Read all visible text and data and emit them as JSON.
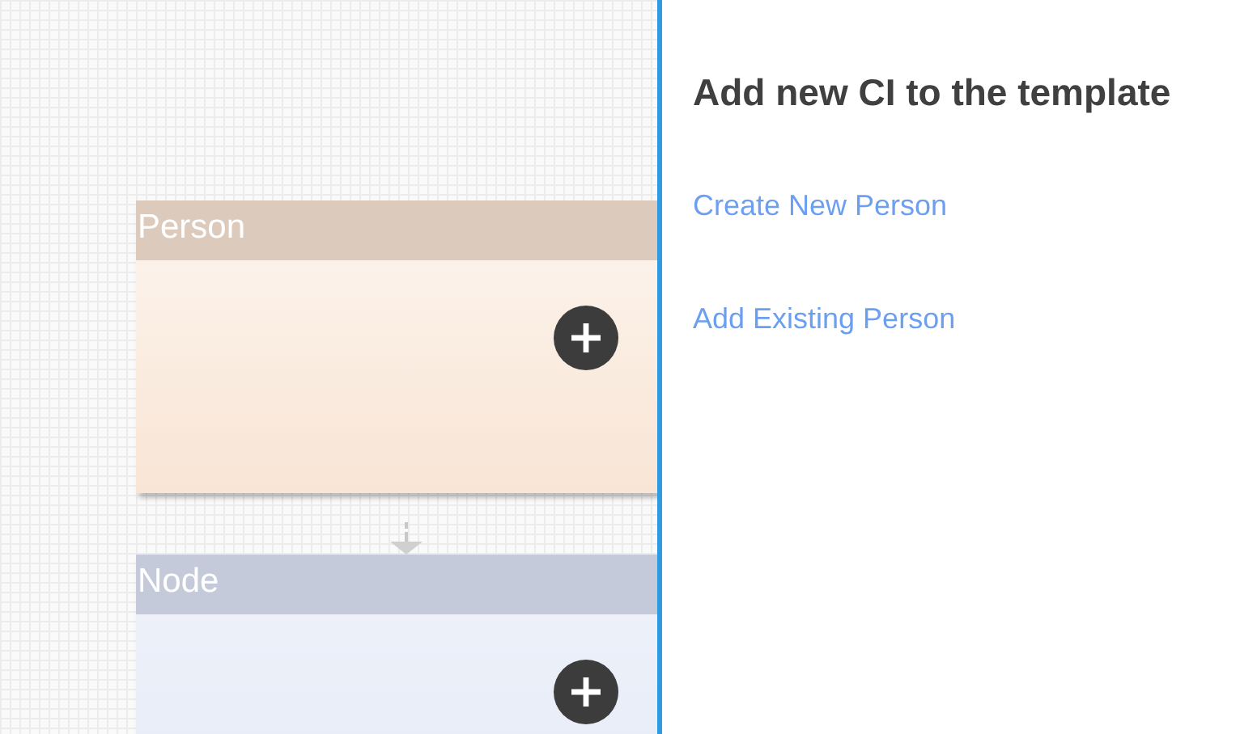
{
  "canvas": {
    "nodes": [
      {
        "title": "Person",
        "kind": "person"
      },
      {
        "title": "Node",
        "kind": "node"
      }
    ]
  },
  "panel": {
    "title": "Add new CI to the template",
    "links": [
      "Create New Person",
      "Add Existing Person"
    ]
  }
}
